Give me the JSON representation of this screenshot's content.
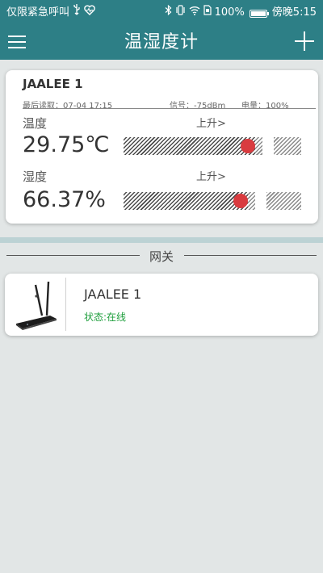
{
  "status_bar": {
    "left_text": "仅限紧急呼叫",
    "usb_icon": "usb-icon",
    "health_icon": "heart-icon",
    "battery_percent": "100%",
    "time": "傍晚5:15"
  },
  "app_bar": {
    "title": "温湿度计",
    "menu_icon": "hamburger-menu-icon",
    "add_icon": "plus-icon"
  },
  "sensor": {
    "name": "JAALEE 1",
    "last_read": "最后读取：07-04 17:15",
    "signal": "信号：-75dBm",
    "battery": "电量：100%",
    "temperature": {
      "label": "温度",
      "trend": "上升>",
      "value": "29.75℃",
      "level": 0.7
    },
    "humidity": {
      "label": "湿度",
      "trend": "上升>",
      "value": "66.37%",
      "level": 0.66
    }
  },
  "gateway_section": {
    "title": "网关",
    "gateways": [
      {
        "name": "JAALEE 1",
        "status": "状态:在线",
        "icon": "router-antenna-icon"
      }
    ]
  },
  "colors": {
    "brand": "#2d7f86",
    "indicator": "#d93b3f",
    "online": "#1e9e3c",
    "background": "#e2e6e6"
  }
}
